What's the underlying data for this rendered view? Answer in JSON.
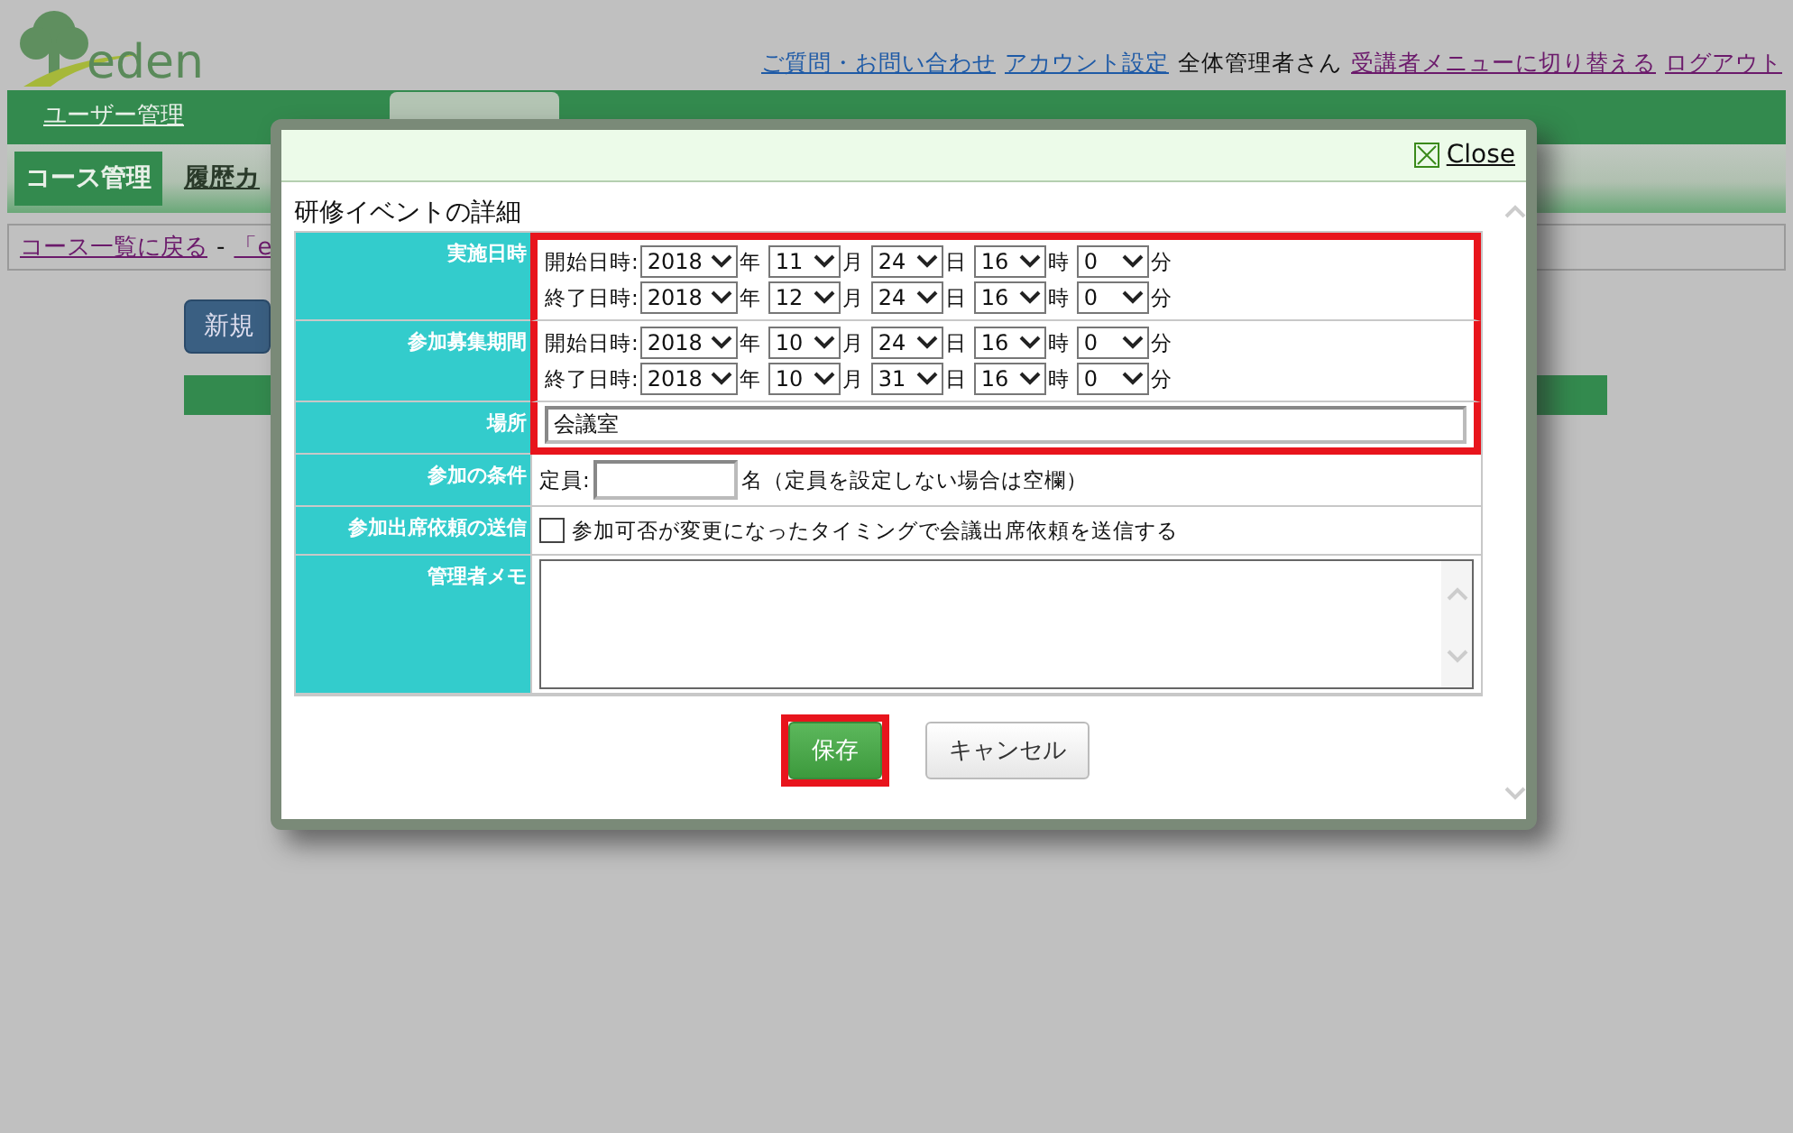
{
  "header": {
    "logo_text": "eden",
    "links": [
      {
        "text": "ご質問・お問い合わせ",
        "kind": "link",
        "visited": false
      },
      {
        "text": "アカウント設定",
        "kind": "link",
        "visited": false
      },
      {
        "text": "全体管理者さん",
        "kind": "plain"
      },
      {
        "text": "受講者メニューに切り替える",
        "kind": "link",
        "visited": true
      },
      {
        "text": "ログアウト",
        "kind": "link",
        "visited": true
      }
    ]
  },
  "nav": {
    "tabs": [
      {
        "label": "ユーザー管理",
        "selected": false
      },
      {
        "selected": false
      },
      {
        "selected": true
      },
      {
        "selected": false
      }
    ]
  },
  "subnav": {
    "items": [
      {
        "label": "コース管理",
        "selected": true
      },
      {
        "label": "履歴カ",
        "selected": false
      }
    ]
  },
  "breadcrumb": {
    "link": "コース一覧に戻る",
    "separator": "-",
    "rest": "「e"
  },
  "new_button": "新規",
  "modal": {
    "close_label": "Close",
    "title": "研修イベントの詳細",
    "rows": [
      {
        "label": "実施日時",
        "kind": "datetime",
        "highlighted": true,
        "lines": [
          {
            "prefix": "開始日時:",
            "parts": [
              {
                "value": "2018",
                "unit": "年"
              },
              {
                "value": "11",
                "unit": "月"
              },
              {
                "value": "24",
                "unit": "日"
              },
              {
                "value": "16",
                "unit": "時"
              },
              {
                "value": "0",
                "unit": "分"
              }
            ]
          },
          {
            "prefix": "終了日時:",
            "parts": [
              {
                "value": "2018",
                "unit": "年"
              },
              {
                "value": "12",
                "unit": "月"
              },
              {
                "value": "24",
                "unit": "日"
              },
              {
                "value": "16",
                "unit": "時"
              },
              {
                "value": "0",
                "unit": "分"
              }
            ]
          }
        ]
      },
      {
        "label": "参加募集期間",
        "kind": "datetime",
        "highlighted": true,
        "lines": [
          {
            "prefix": "開始日時:",
            "parts": [
              {
                "value": "2018",
                "unit": "年"
              },
              {
                "value": "10",
                "unit": "月"
              },
              {
                "value": "24",
                "unit": "日"
              },
              {
                "value": "16",
                "unit": "時"
              },
              {
                "value": "0",
                "unit": "分"
              }
            ]
          },
          {
            "prefix": "終了日時:",
            "parts": [
              {
                "value": "2018",
                "unit": "年"
              },
              {
                "value": "10",
                "unit": "月"
              },
              {
                "value": "31",
                "unit": "日"
              },
              {
                "value": "16",
                "unit": "時"
              },
              {
                "value": "0",
                "unit": "分"
              }
            ]
          }
        ]
      },
      {
        "label": "場所",
        "kind": "text",
        "highlighted": true,
        "value": "会議室"
      },
      {
        "label": "参加の条件",
        "kind": "capacity",
        "highlighted": false,
        "prefix": "定員:",
        "suffix": "名（定員を設定しない場合は空欄）"
      },
      {
        "label": "参加出席依頼の送信",
        "kind": "checkbox",
        "highlighted": false,
        "checked": false,
        "text": "参加可否が変更になったタイミングで会議出席依頼を送信する"
      },
      {
        "label": "管理者メモ",
        "kind": "textarea",
        "highlighted": false
      }
    ],
    "buttons": [
      {
        "label": "保存",
        "kind": "primary",
        "highlighted": true
      },
      {
        "label": "キャンセル",
        "kind": "secondary",
        "highlighted": false
      }
    ]
  }
}
